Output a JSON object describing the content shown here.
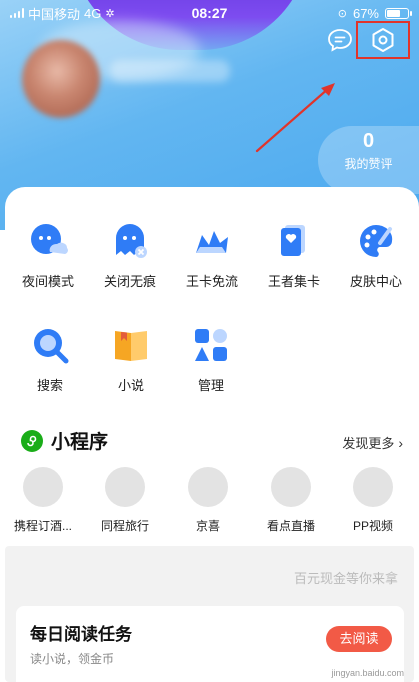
{
  "status_bar": {
    "carrier": "中国移动",
    "network": "4G",
    "time": "08:27",
    "battery": "67%",
    "battery_level": 0.67
  },
  "header": {
    "likes_count": "0",
    "likes_label": "我的赞评"
  },
  "functions_row1": [
    {
      "label": "夜间模式",
      "icon": "night-mode-icon"
    },
    {
      "label": "关闭无痕",
      "icon": "close-incognito-icon"
    },
    {
      "label": "王卡免流",
      "icon": "king-card-icon"
    },
    {
      "label": "王者集卡",
      "icon": "card-collection-icon"
    },
    {
      "label": "皮肤中心",
      "icon": "palette-icon"
    }
  ],
  "functions_row2": [
    {
      "label": "搜索",
      "icon": "search-icon"
    },
    {
      "label": "小说",
      "icon": "book-icon"
    },
    {
      "label": "管理",
      "icon": "manage-icon"
    }
  ],
  "mini_programs": {
    "title": "小程序",
    "discover_more": "发现更多",
    "items": [
      {
        "label": "携程订酒..."
      },
      {
        "label": "同程旅行"
      },
      {
        "label": "京喜"
      },
      {
        "label": "看点直播"
      },
      {
        "label": "PP视频"
      }
    ]
  },
  "promo_text": "百元现金等你来拿",
  "reading_task": {
    "title": "每日阅读任务",
    "subtitle": "读小说，领金币",
    "button": "去阅读"
  },
  "watermark": "jingyan.baidu.com",
  "colors": {
    "header_blue": "#62b6f1",
    "accent_red": "#e1342b",
    "icon_blue": "#2f7cf6",
    "icon_orange": "#f6a623"
  }
}
